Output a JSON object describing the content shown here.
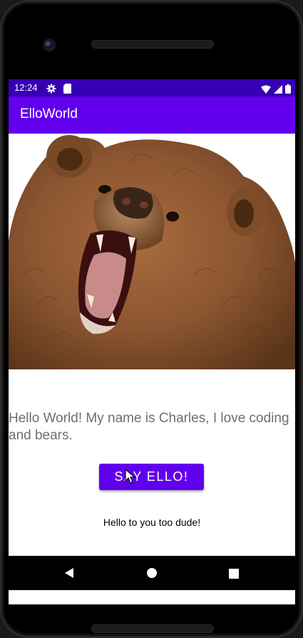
{
  "status_bar": {
    "time": "12:24",
    "icons": [
      "gear-icon",
      "sd-card-icon",
      "wifi-icon",
      "signal-icon",
      "battery-icon"
    ],
    "color": "#3700b3"
  },
  "app_bar": {
    "title": "ElloWorld",
    "color": "#6200ee"
  },
  "main": {
    "image": "bear-photo",
    "greeting_text": "Hello World! My name is Charles, I love coding and bears.",
    "button_label": "SAY ELLO!",
    "response_text": "Hello to you too dude!"
  },
  "nav_bar": {
    "buttons": [
      "back-icon",
      "home-icon",
      "recents-icon"
    ]
  }
}
